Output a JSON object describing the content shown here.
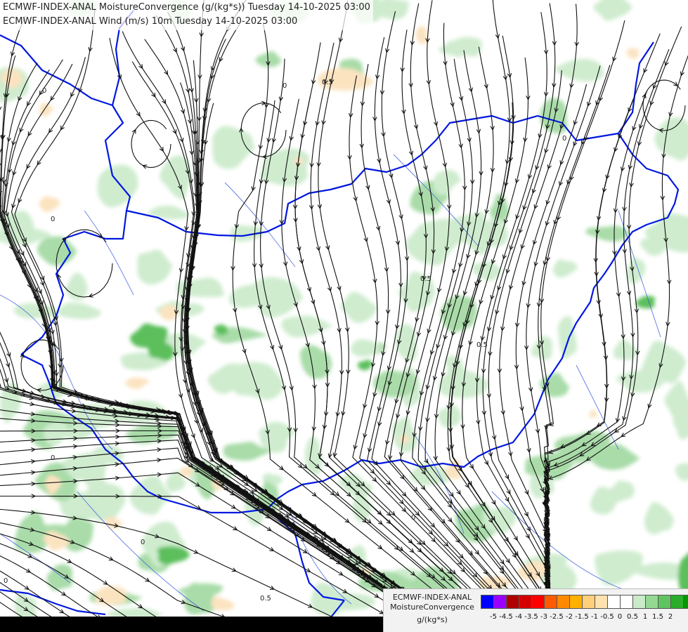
{
  "titles": {
    "line1": "ECMWF-INDEX-ANAL MoistureConvergence (g/(kg*s)) Tuesday 14-10-2025 03:00",
    "line2": "ECMWF-INDEX-ANAL Wind (m/s) 10m Tuesday 14-10-2025 03:00"
  },
  "legend": {
    "title": "ECMWF-INDEX-ANAL",
    "subtitle": "MoistureConvergence",
    "unit": "g/(kg*s)",
    "colors": [
      "#0000ff",
      "#9b00ff",
      "#b00000",
      "#d40000",
      "#ff0000",
      "#ff5a00",
      "#ff8a00",
      "#ffb000",
      "#ffcf7a",
      "#ffe2b0",
      "#ffffff",
      "#ffffff",
      "#c9ebc9",
      "#94d894",
      "#5fc35f",
      "#2aae2a",
      "#009900"
    ],
    "labels": [
      "-5",
      "-4.5",
      "-4",
      "-3.5",
      "-3",
      "-2.5",
      "-2",
      "-1.5",
      "-1",
      "-0.5",
      "0",
      "0.5",
      "1",
      "1.5",
      "2"
    ]
  },
  "map": {
    "contour_labels": [
      "0",
      "0",
      "0",
      "0.5",
      "0.5",
      "0.5",
      "0",
      "0",
      "0",
      "0",
      "0.5",
      "0",
      "0"
    ],
    "field_colors": {
      "green_light": "#cfeccf",
      "green_mid": "#a9dca9",
      "green_dark": "#5bbf5b",
      "orange_light": "#fbe3c0",
      "border_blue": "#0018e0",
      "river_blue": "#3a5adb"
    }
  }
}
